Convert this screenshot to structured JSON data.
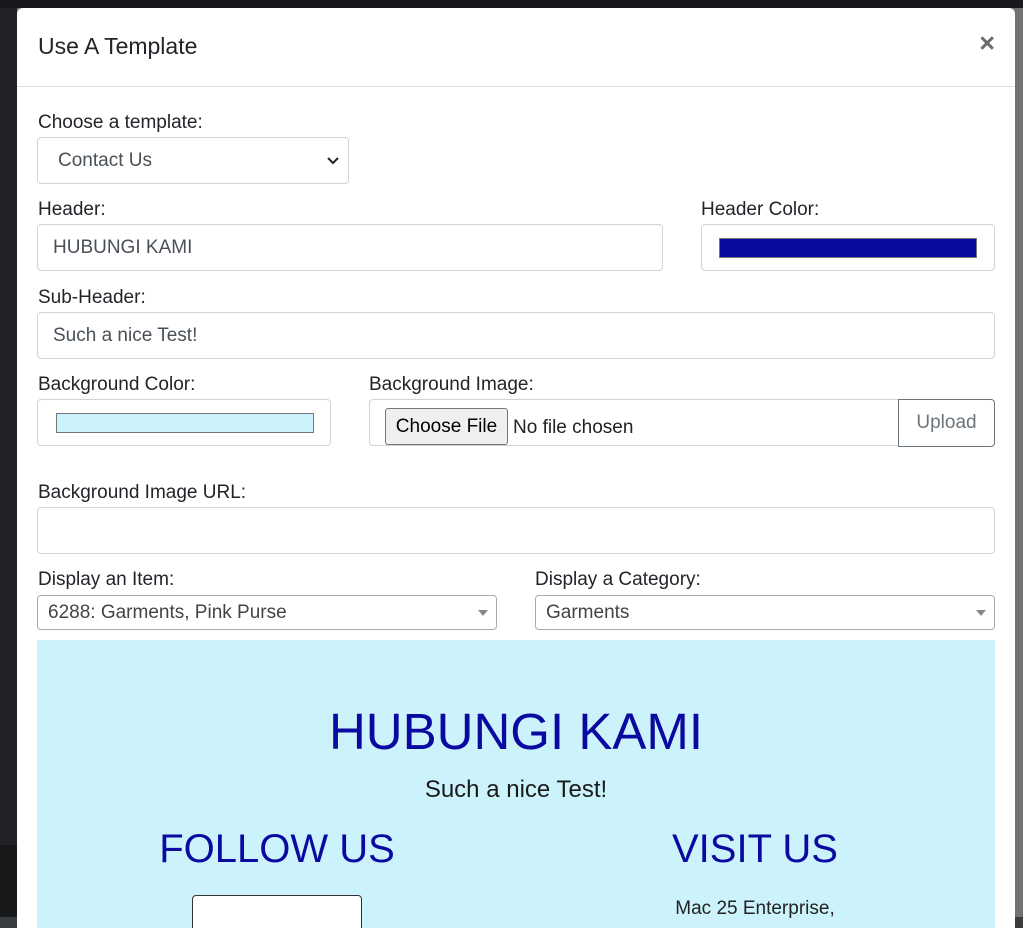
{
  "modal": {
    "title": "Use A Template",
    "close_glyph": "×"
  },
  "form": {
    "template_label": "Choose a template:",
    "template_value": "Contact Us",
    "header_label": "Header:",
    "header_value": "HUBUNGI KAMI",
    "header_color_label": "Header Color:",
    "header_color": "#0a0aa0",
    "subheader_label": "Sub-Header:",
    "subheader_value": "Such a nice Test!",
    "bg_color_label": "Background Color:",
    "bg_color": "#ccf2fb",
    "bg_image_label": "Background Image:",
    "choose_file_label": "Choose File",
    "no_file_text": "No file chosen",
    "upload_label": "Upload",
    "bg_image_url_label": "Background Image URL:",
    "bg_image_url_value": "",
    "item_label": "Display an Item:",
    "item_value": "6288: Garments, Pink Purse",
    "category_label": "Display a Category:",
    "category_value": "Garments"
  },
  "preview": {
    "title": "HUBUNGI KAMI",
    "subtitle": "Such a nice Test!",
    "follow_heading": "FOLLOW US",
    "visit_heading": "VISIT US",
    "address_line1": "Mac 25 Enterprise,"
  },
  "icons": {
    "select_chevron": "chevron-down-icon",
    "dropdown_arrow": "triangle-down-icon"
  }
}
